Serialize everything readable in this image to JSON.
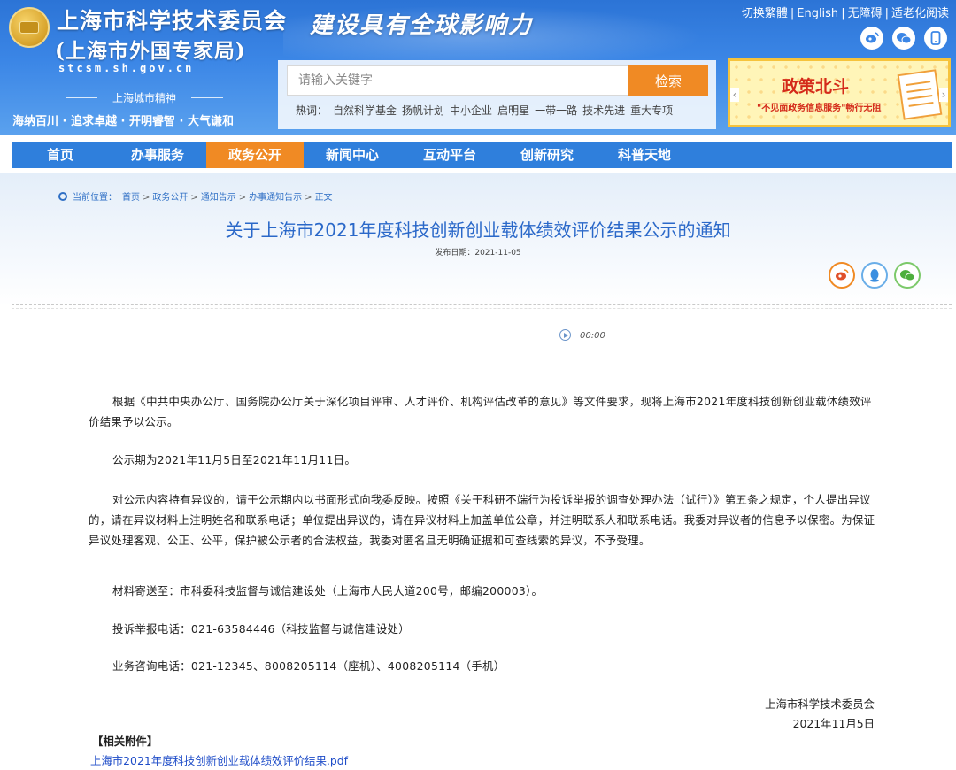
{
  "header": {
    "site_title": "上海市科学技术委员会",
    "site_subtitle": "(上海市外国专家局)",
    "domain": "stcsm.sh.gov.cn",
    "spirit_label": "上海城市精神",
    "spirit_text": "海纳百川 · 追求卓越 · 开明睿智 · 大气谦和",
    "slogan": "建设具有全球影响力",
    "top_links": [
      "切换繁體",
      "English",
      "无障碍",
      "适老化阅读"
    ],
    "social_icons": [
      "weibo-icon",
      "wechat-icon",
      "mobile-icon"
    ]
  },
  "search": {
    "placeholder": "请输入关键字",
    "button_label": "检索",
    "hot_label": "热词：",
    "hot_words": [
      "自然科学基金",
      "扬帆计划",
      "中小企业",
      "启明星",
      "一带一路",
      "技术先进",
      "重大专项"
    ]
  },
  "banner": {
    "title": "政策北斗",
    "subtitle": "\"不见面政务信息服务\"畅行无阻"
  },
  "nav": {
    "items": [
      "首页",
      "办事服务",
      "政务公开",
      "新闻中心",
      "互动平台",
      "创新研究",
      "科普天地"
    ],
    "active": "政务公开"
  },
  "breadcrumb": {
    "label": "当前位置：",
    "items": [
      "首页",
      "政务公开",
      "通知告示",
      "办事通知告示",
      "正文"
    ]
  },
  "article": {
    "title": "关于上海市2021年度科技创新创业载体绩效评价结果公示的通知",
    "date_label": "发布日期：",
    "date": "2021-11-05",
    "audio_time": "00:00",
    "paragraphs": [
      "根据《中共中央办公厅、国务院办公厅关于深化项目评审、人才评价、机构评估改革的意见》等文件要求，现将上海市2021年度科技创新创业载体绩效评价结果予以公示。",
      "公示期为2021年11月5日至2021年11月11日。",
      "对公示内容持有异议的，请于公示期内以书面形式向我委反映。按照《关于科研不端行为投诉举报的调查处理办法（试行）》第五条之规定，个人提出异议的，请在异议材料上注明姓名和联系电话；单位提出异议的，请在异议材料上加盖单位公章，并注明联系人和联系电话。我委对异议者的信息予以保密。为保证异议处理客观、公正、公平，保护被公示者的合法权益，我委对匿名且无明确证据和可查线索的异议，不予受理。",
      "材料寄送至：市科委科技监督与诚信建设处（上海市人民大道200号，邮编200003）。",
      "投诉举报电话：021-63584446（科技监督与诚信建设处）",
      "业务咨询电话：021-12345、8008205114（座机）、4008205114（手机）"
    ],
    "signature_org": "上海市科学技术委员会",
    "signature_date": "2021年11月5日",
    "attachment_label": "【相关附件】",
    "attachment_link": "上海市2021年度科技创新创业载体绩效评价结果.pdf"
  },
  "share_icons": [
    "weibo-share-icon",
    "qq-share-icon",
    "wechat-share-icon"
  ],
  "colors": {
    "header_blue": "#3b86e6",
    "nav_blue": "#2f7fdc",
    "accent_orange": "#f08a24",
    "title_blue": "#2a68c9",
    "link_blue": "#1f4dc8"
  }
}
